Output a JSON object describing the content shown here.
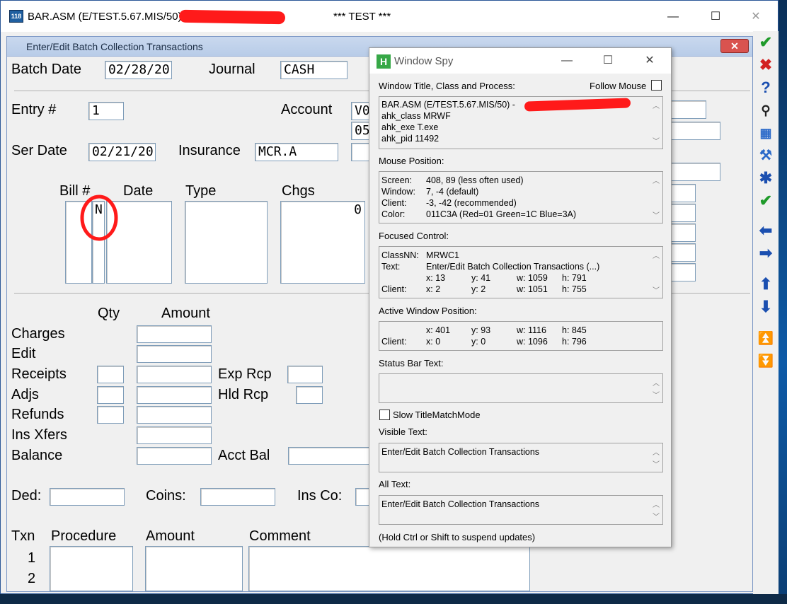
{
  "outer_window": {
    "icon_text": "118",
    "title": "BAR.ASM (E/TEST.5.67.MIS/50) - ",
    "center_title": "*** TEST ***",
    "min_label": "—",
    "max_label": "☐",
    "close_label": "✕"
  },
  "inner_window": {
    "title": "Enter/Edit Batch Collection Transactions",
    "close_label": "✕"
  },
  "form": {
    "batch_date_label": "Batch Date",
    "batch_date_value": "02/28/20",
    "journal_label": "Journal",
    "journal_value": "CASH",
    "entry_label": "Entry #",
    "entry_value": "1",
    "account_label": "Account",
    "account_value": "V0",
    "account_value2": "05",
    "ser_date_label": "Ser Date",
    "ser_date_value": "02/21/20",
    "insurance_label": "Insurance",
    "insurance_value": "MCR.A",
    "bill_label": "Bill #",
    "bill_value": "N",
    "date_label": "Date",
    "type_label": "Type",
    "chgs_label": "Chgs",
    "chgs_value": "0",
    "qty_label": "Qty",
    "amount_label": "Amount",
    "charges_label": "Charges",
    "edit_label": "Edit",
    "receipts_label": "Receipts",
    "adjs_label": "Adjs",
    "refunds_label": "Refunds",
    "ins_xfers_label": "Ins Xfers",
    "balance_label": "Balance",
    "exp_rcp_label": "Exp Rcp",
    "hld_rcp_label": "Hld Rcp",
    "acct_bal_label": "Acct Bal",
    "ded_label": "Ded:",
    "coins_label": "Coins:",
    "ins_co_label": "Ins Co:",
    "txn_label": "Txn",
    "procedure_label": "Procedure",
    "txn_amount_label": "Amount",
    "comment_label": "Comment",
    "row1": "1",
    "row2": "2"
  },
  "toolbar": {
    "icons": [
      "check-icon",
      "cancel-icon",
      "help-icon",
      "binoculars-icon",
      "calendar-icon",
      "tools-icon",
      "asterisk-icon",
      "check-all-icon",
      "arrow-left-icon",
      "arrow-right-icon",
      "arrow-up-icon",
      "arrow-down-icon",
      "double-up-icon",
      "double-down-icon"
    ]
  },
  "window_spy": {
    "title": "Window Spy",
    "min_label": "—",
    "max_label": "☐",
    "close_label": "✕",
    "section_title": "Window Title, Class and Process:",
    "follow_mouse": "Follow Mouse",
    "title_lines": [
      "BAR.ASM (E/TEST.5.67.MIS/50) -",
      "ahk_class MRWF",
      "ahk_exe T.exe",
      "ahk_pid 11492"
    ],
    "mouse_section": "Mouse Position:",
    "mouse": {
      "screen_label": "Screen:",
      "screen_value": "408, 89 (less often used)",
      "window_label": "Window:",
      "window_value": "7, -4 (default)",
      "client_label": "Client:",
      "client_value": "-3, -42 (recommended)",
      "color_label": "Color:",
      "color_value": "011C3A (Red=01 Green=1C Blue=3A)"
    },
    "focused_section": "Focused Control:",
    "focused": {
      "classnn_label": "ClassNN:",
      "classnn_value": "MRWC1",
      "text_label": "Text:",
      "text_value": "Enter/Edit Batch Collection Transactions (...)",
      "x1": "x: 13",
      "y1": "y: 41",
      "w1": "w: 1059",
      "h1": "h: 791",
      "client_label": "Client:",
      "x2": "x: 2",
      "y2": "y: 2",
      "w2": "w: 1051",
      "h2": "h: 755"
    },
    "active_section": "Active Window Position:",
    "active": {
      "x1": "x: 401",
      "y1": "y: 93",
      "w1": "w: 1116",
      "h1": "h: 845",
      "client_label": "Client:",
      "x2": "x: 0",
      "y2": "y: 0",
      "w2": "w: 1096",
      "h2": "h: 796"
    },
    "status_section": "Status Bar Text:",
    "slow_title": "Slow TitleMatchMode",
    "visible_section": "Visible Text:",
    "visible_text": "Enter/Edit Batch Collection Transactions",
    "all_section": "All Text:",
    "all_text": "Enter/Edit Batch Collection Transactions",
    "footer": "(Hold Ctrl or Shift to suspend updates)"
  }
}
